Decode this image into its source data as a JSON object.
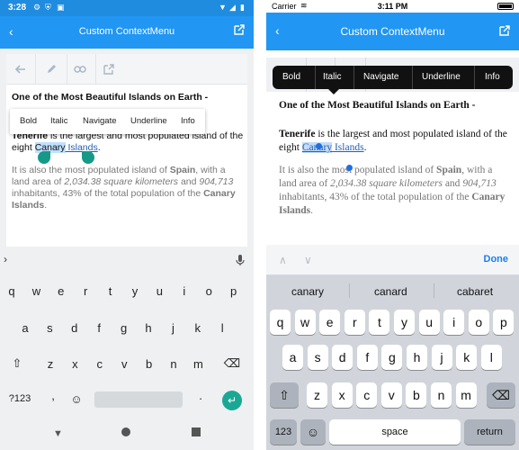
{
  "android": {
    "status": {
      "time": "3:28"
    },
    "toolbar": {
      "title": "Custom ContextMenu"
    },
    "document": {
      "title": "One of the Most Beautiful Islands on Earth -",
      "p1": {
        "bold": "Tenerife",
        "text": " is the largest and most populated island of the eight ",
        "selected": "Canary",
        "link": " Islands",
        "end": "."
      },
      "p2": {
        "pre": "It is also the most populated island of ",
        "bold": "Spain",
        "mid": ", with a land area of ",
        "italic1": "2,034.38 square kilometers",
        "and": " and ",
        "italic2": "904,713",
        "post": " inhabitants, 43% of the total population of the ",
        "bold2": "Canary Islands",
        "end": "."
      }
    },
    "context_menu": [
      "Bold",
      "Italic",
      "Navigate",
      "Underline",
      "Info"
    ],
    "keyboard": {
      "row1": [
        "q",
        "w",
        "e",
        "r",
        "t",
        "y",
        "u",
        "i",
        "o",
        "p"
      ],
      "row2": [
        "a",
        "s",
        "d",
        "f",
        "g",
        "h",
        "j",
        "k",
        "l"
      ],
      "row3": [
        "z",
        "x",
        "c",
        "v",
        "b",
        "n",
        "m"
      ],
      "symbols": "?123",
      "comma": ",",
      "period": "."
    }
  },
  "ios": {
    "status": {
      "carrier": "Carrier",
      "time": "3:11 PM"
    },
    "toolbar": {
      "title": "Custom ContextMenu"
    },
    "context_menu": [
      "Bold",
      "Italic",
      "Navigate",
      "Underline",
      "Info"
    ],
    "accessory": {
      "done": "Done"
    },
    "predictions": [
      "canary",
      "canard",
      "cabaret"
    ],
    "keyboard": {
      "row1": [
        "q",
        "w",
        "e",
        "r",
        "t",
        "y",
        "u",
        "i",
        "o",
        "p"
      ],
      "row2": [
        "a",
        "s",
        "d",
        "f",
        "g",
        "h",
        "j",
        "k",
        "l"
      ],
      "row3": [
        "z",
        "x",
        "c",
        "v",
        "b",
        "n",
        "m"
      ],
      "numbers": "123",
      "space": "space",
      "return": "return"
    }
  },
  "colors": {
    "accent": "#2196f3",
    "android_handle": "#159a88",
    "ios_selection": "#1f6fe0"
  }
}
